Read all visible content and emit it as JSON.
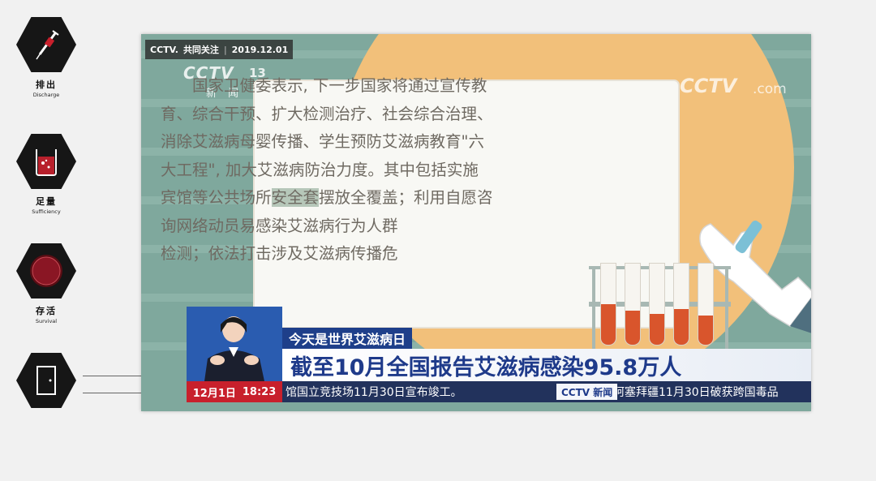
{
  "sidebar": {
    "items": [
      {
        "cn": "排出",
        "en": "Discharge",
        "icon": "syringe-icon"
      },
      {
        "cn": "足量",
        "en": "Sufficiency",
        "icon": "beaker-icon"
      },
      {
        "cn": "存活",
        "en": "Survival",
        "icon": "cell-icon"
      },
      {
        "cn": "",
        "en": "",
        "icon": "door-icon"
      }
    ]
  },
  "video": {
    "source_tag": {
      "brand": "CCTV.",
      "program": "共同关注",
      "date": "2019.12.01"
    },
    "channel": {
      "logo": "CCTV",
      "number": "13",
      "subtitle": "新闻"
    },
    "watermark": {
      "logo": "CCTV",
      "suffix": ".com"
    },
    "card_lines": [
      "国家卫健委表示, 下一步国家将通过宣传教",
      "育、综合干预、扩大检测治疗、社会综合治理、",
      "消除艾滋病母婴传播、学生预防艾滋病教育\"六",
      "大工程\", 加大艾滋病防治力度。其中包括实施",
      {
        "pre": "宾馆等公共场所",
        "highlight": "安全套",
        "post": "摆放全覆盖；利用自愿咨"
      },
      "询网络动员易感染艾滋病行为人群",
      "检测；依法打击涉及艾滋病传播危"
    ],
    "lower_third": {
      "topic": "今天是世界艾滋病日",
      "headline": "截至10月全国报告艾滋病感染95.8万人"
    },
    "ticker": {
      "date": "12月1日",
      "time": "18:23",
      "item1": "馆国立竞技场11月30日宣布竣工。",
      "logo": "CCTV 新闻",
      "item2": "阿塞拜疆11月30日破获跨国毒品"
    }
  },
  "colors": {
    "accent_orange": "#f2c07a",
    "teal": "#7fa89d",
    "news_blue": "#1e3f8a",
    "ticker_red": "#c8202c"
  }
}
